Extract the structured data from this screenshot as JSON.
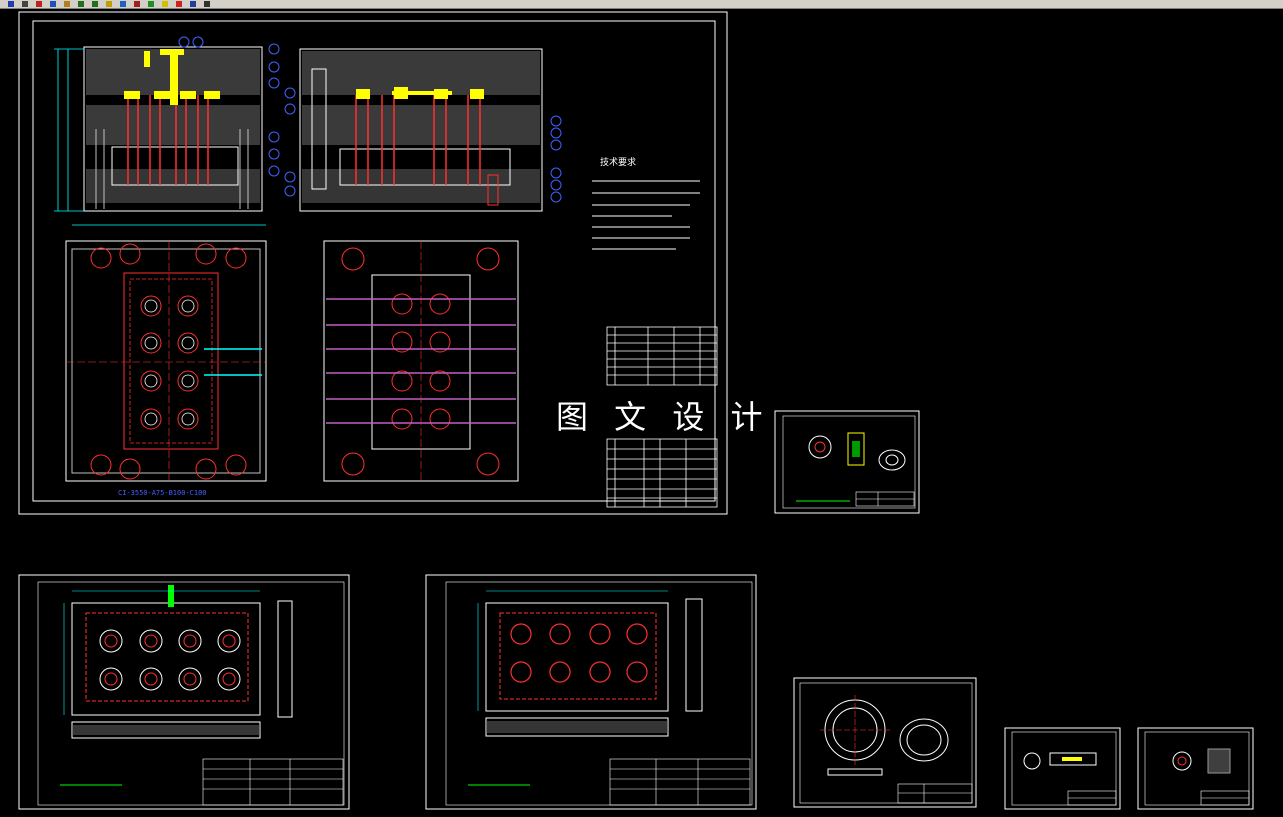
{
  "toolbar": {
    "icons": [
      {
        "name": "save-icon",
        "color": "#1f3fb0"
      },
      {
        "name": "print-icon",
        "color": "#444444"
      },
      {
        "name": "cut-icon",
        "color": "#c02020"
      },
      {
        "name": "copy-icon",
        "color": "#2050c0"
      },
      {
        "name": "paste-icon",
        "color": "#b08020"
      },
      {
        "name": "undo-icon",
        "color": "#207020"
      },
      {
        "name": "redo-icon",
        "color": "#207020"
      },
      {
        "name": "pan-icon",
        "color": "#c0a000"
      },
      {
        "name": "zoom-icon",
        "color": "#2060c0"
      },
      {
        "name": "zoom-window-icon",
        "color": "#a02020"
      },
      {
        "name": "properties-icon",
        "color": "#209020"
      },
      {
        "name": "layer-icon",
        "color": "#d0c000"
      },
      {
        "name": "color-icon",
        "color": "#d02020"
      },
      {
        "name": "linetype-icon",
        "color": "#2040a0"
      },
      {
        "name": "help-icon",
        "color": "#303030"
      }
    ]
  },
  "drawing": {
    "watermark": "图 文 设 计",
    "main_sheet": {
      "tech_req_title": "技术要求",
      "mold_base_label": "CI-3550-A75-B100-C100"
    },
    "colors": {
      "frame": "#ffffff",
      "mold": "#ffff00",
      "cavity": "#ff3030",
      "dimension": "#00ffff",
      "callout": "#4060ff",
      "hatch": "#c0c0c0",
      "titleblock": "#ffffff",
      "text": "#00ff00"
    }
  }
}
